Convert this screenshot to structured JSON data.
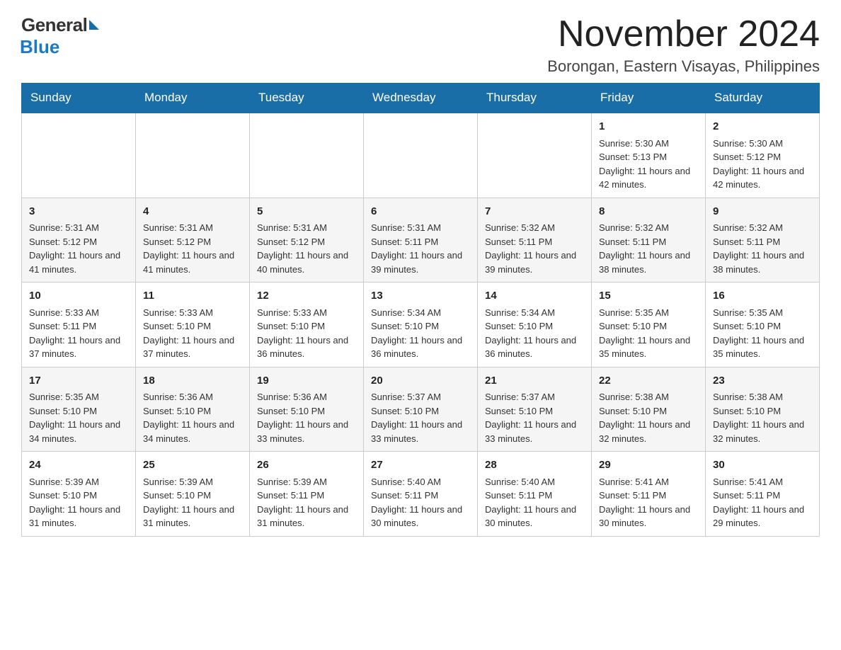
{
  "logo": {
    "general": "General",
    "blue": "Blue"
  },
  "header": {
    "title": "November 2024",
    "location": "Borongan, Eastern Visayas, Philippines"
  },
  "days": [
    "Sunday",
    "Monday",
    "Tuesday",
    "Wednesday",
    "Thursday",
    "Friday",
    "Saturday"
  ],
  "weeks": [
    {
      "cells": [
        {
          "day": "",
          "content": ""
        },
        {
          "day": "",
          "content": ""
        },
        {
          "day": "",
          "content": ""
        },
        {
          "day": "",
          "content": ""
        },
        {
          "day": "",
          "content": ""
        },
        {
          "day": "1",
          "content": "Sunrise: 5:30 AM\nSunset: 5:13 PM\nDaylight: 11 hours and 42 minutes."
        },
        {
          "day": "2",
          "content": "Sunrise: 5:30 AM\nSunset: 5:12 PM\nDaylight: 11 hours and 42 minutes."
        }
      ]
    },
    {
      "cells": [
        {
          "day": "3",
          "content": "Sunrise: 5:31 AM\nSunset: 5:12 PM\nDaylight: 11 hours and 41 minutes."
        },
        {
          "day": "4",
          "content": "Sunrise: 5:31 AM\nSunset: 5:12 PM\nDaylight: 11 hours and 41 minutes."
        },
        {
          "day": "5",
          "content": "Sunrise: 5:31 AM\nSunset: 5:12 PM\nDaylight: 11 hours and 40 minutes."
        },
        {
          "day": "6",
          "content": "Sunrise: 5:31 AM\nSunset: 5:11 PM\nDaylight: 11 hours and 39 minutes."
        },
        {
          "day": "7",
          "content": "Sunrise: 5:32 AM\nSunset: 5:11 PM\nDaylight: 11 hours and 39 minutes."
        },
        {
          "day": "8",
          "content": "Sunrise: 5:32 AM\nSunset: 5:11 PM\nDaylight: 11 hours and 38 minutes."
        },
        {
          "day": "9",
          "content": "Sunrise: 5:32 AM\nSunset: 5:11 PM\nDaylight: 11 hours and 38 minutes."
        }
      ]
    },
    {
      "cells": [
        {
          "day": "10",
          "content": "Sunrise: 5:33 AM\nSunset: 5:11 PM\nDaylight: 11 hours and 37 minutes."
        },
        {
          "day": "11",
          "content": "Sunrise: 5:33 AM\nSunset: 5:10 PM\nDaylight: 11 hours and 37 minutes."
        },
        {
          "day": "12",
          "content": "Sunrise: 5:33 AM\nSunset: 5:10 PM\nDaylight: 11 hours and 36 minutes."
        },
        {
          "day": "13",
          "content": "Sunrise: 5:34 AM\nSunset: 5:10 PM\nDaylight: 11 hours and 36 minutes."
        },
        {
          "day": "14",
          "content": "Sunrise: 5:34 AM\nSunset: 5:10 PM\nDaylight: 11 hours and 36 minutes."
        },
        {
          "day": "15",
          "content": "Sunrise: 5:35 AM\nSunset: 5:10 PM\nDaylight: 11 hours and 35 minutes."
        },
        {
          "day": "16",
          "content": "Sunrise: 5:35 AM\nSunset: 5:10 PM\nDaylight: 11 hours and 35 minutes."
        }
      ]
    },
    {
      "cells": [
        {
          "day": "17",
          "content": "Sunrise: 5:35 AM\nSunset: 5:10 PM\nDaylight: 11 hours and 34 minutes."
        },
        {
          "day": "18",
          "content": "Sunrise: 5:36 AM\nSunset: 5:10 PM\nDaylight: 11 hours and 34 minutes."
        },
        {
          "day": "19",
          "content": "Sunrise: 5:36 AM\nSunset: 5:10 PM\nDaylight: 11 hours and 33 minutes."
        },
        {
          "day": "20",
          "content": "Sunrise: 5:37 AM\nSunset: 5:10 PM\nDaylight: 11 hours and 33 minutes."
        },
        {
          "day": "21",
          "content": "Sunrise: 5:37 AM\nSunset: 5:10 PM\nDaylight: 11 hours and 33 minutes."
        },
        {
          "day": "22",
          "content": "Sunrise: 5:38 AM\nSunset: 5:10 PM\nDaylight: 11 hours and 32 minutes."
        },
        {
          "day": "23",
          "content": "Sunrise: 5:38 AM\nSunset: 5:10 PM\nDaylight: 11 hours and 32 minutes."
        }
      ]
    },
    {
      "cells": [
        {
          "day": "24",
          "content": "Sunrise: 5:39 AM\nSunset: 5:10 PM\nDaylight: 11 hours and 31 minutes."
        },
        {
          "day": "25",
          "content": "Sunrise: 5:39 AM\nSunset: 5:10 PM\nDaylight: 11 hours and 31 minutes."
        },
        {
          "day": "26",
          "content": "Sunrise: 5:39 AM\nSunset: 5:11 PM\nDaylight: 11 hours and 31 minutes."
        },
        {
          "day": "27",
          "content": "Sunrise: 5:40 AM\nSunset: 5:11 PM\nDaylight: 11 hours and 30 minutes."
        },
        {
          "day": "28",
          "content": "Sunrise: 5:40 AM\nSunset: 5:11 PM\nDaylight: 11 hours and 30 minutes."
        },
        {
          "day": "29",
          "content": "Sunrise: 5:41 AM\nSunset: 5:11 PM\nDaylight: 11 hours and 30 minutes."
        },
        {
          "day": "30",
          "content": "Sunrise: 5:41 AM\nSunset: 5:11 PM\nDaylight: 11 hours and 29 minutes."
        }
      ]
    }
  ]
}
